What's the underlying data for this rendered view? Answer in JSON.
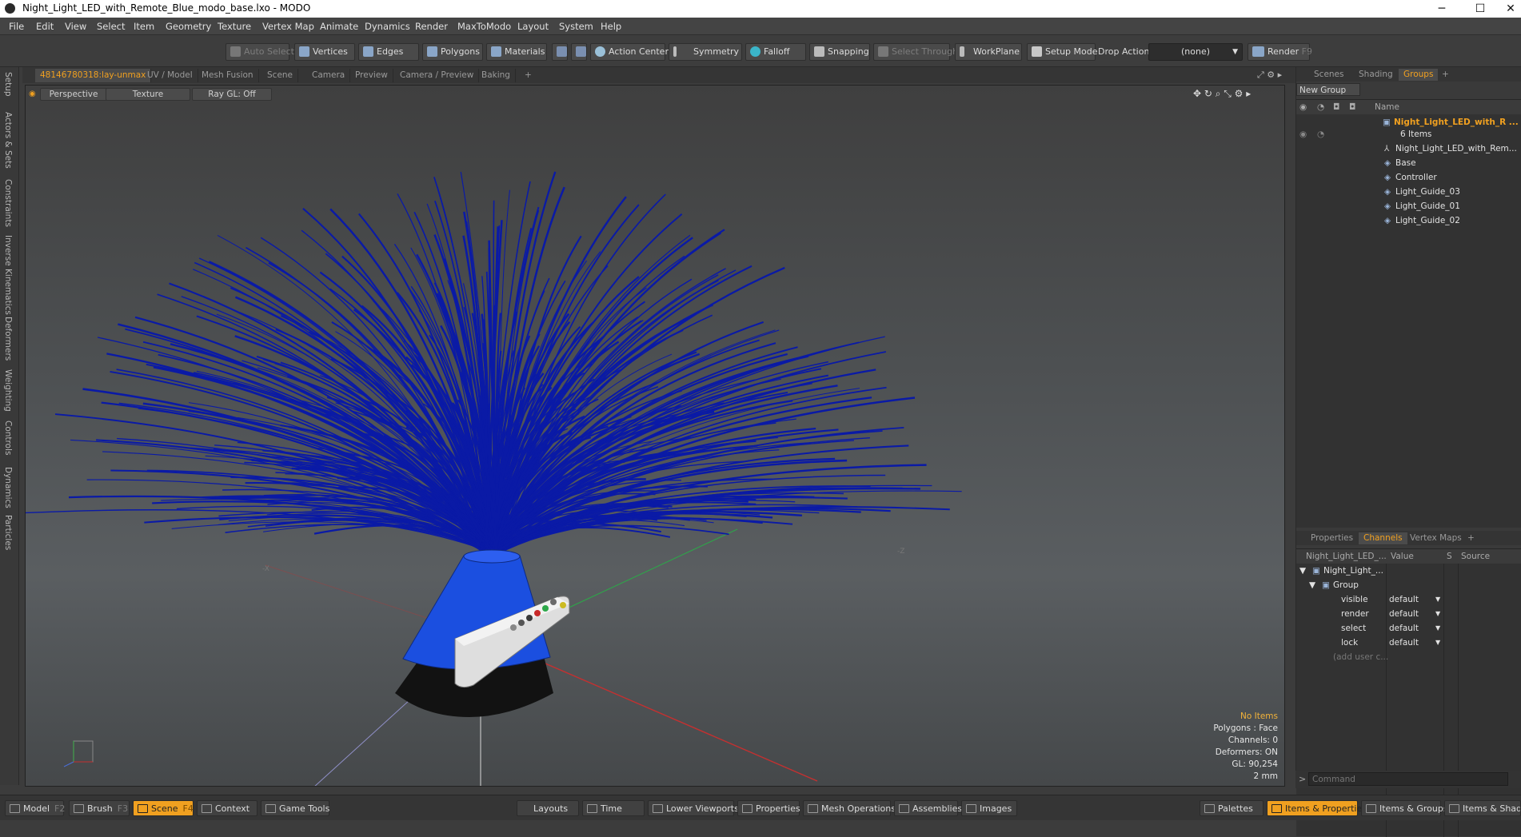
{
  "window": {
    "title": "Night_Light_LED_with_Remote_Blue_modo_base.lxo - MODO",
    "minimize": "─",
    "maximize": "☐",
    "close": "✕"
  },
  "menu": [
    "File",
    "Edit",
    "View",
    "Select",
    "Item",
    "Geometry",
    "Texture",
    "Vertex Map",
    "Animate",
    "Dynamics",
    "Render",
    "MaxToModo",
    "Layout",
    "System",
    "Help"
  ],
  "toolbar": {
    "auto_select": "Auto Select",
    "vertices": "Vertices",
    "edges": "Edges",
    "polygons": "Polygons",
    "materials": "Materials",
    "action_center": "Action Center",
    "symmetry": "Symmetry",
    "falloff": "Falloff",
    "snapping": "Snapping",
    "select_through": "Select Through",
    "workplane": "WorkPlane",
    "setup_mode": "Setup Mode",
    "drop_action": "Drop Action",
    "drop_value": "(none)",
    "render": "Render",
    "render_key": "F9"
  },
  "left_tabs": [
    "Setup",
    "Actors & Sets",
    "Constraints",
    "Inverse Kinematics",
    "Deformers",
    "Weighting",
    "Controls",
    "Dynamics",
    "Particles"
  ],
  "viewport_tabs": [
    "48146780318:lay-unmax",
    "UV / Model",
    "Mesh Fusion",
    "Scene",
    "Camera",
    "Preview",
    "Camera / Preview",
    "Baking",
    "+"
  ],
  "viewport": {
    "view": "Perspective",
    "shading": "Texture",
    "raygl": "Ray GL: Off",
    "axis_x": "-X",
    "axis_z": "-Z",
    "stats": {
      "items": "No Items",
      "polygons": "Polygons : Face",
      "channels": "Channels: 0",
      "deformers": "Deformers: ON",
      "gl": "GL: 90,254",
      "size": "2 mm"
    },
    "colors": {
      "fibers": "#0a1aa6",
      "base_top": "#1a4bd8",
      "base_bottom": "#121212"
    }
  },
  "scene_panel": {
    "tabs": [
      "Scenes",
      "Shading",
      "Groups",
      "+"
    ],
    "new_group": "New Group",
    "name_header": "Name",
    "group_name": "Night_Light_LED_with_R ...",
    "group_count": "6 Items",
    "items": [
      "Night_Light_LED_with_Rem...",
      "Base",
      "Controller",
      "Light_Guide_03",
      "Light_Guide_01",
      "Light_Guide_02"
    ]
  },
  "channels_panel": {
    "tabs": [
      "Properties",
      "Channels",
      "Vertex Maps",
      "+"
    ],
    "headers": {
      "name": "Night_Light_LED_...",
      "value": "Value",
      "s": "S",
      "source": "Source"
    },
    "root": "Night_Light_...",
    "group": "Group",
    "rows": [
      {
        "name": "visible",
        "value": "default"
      },
      {
        "name": "render",
        "value": "default"
      },
      {
        "name": "select",
        "value": "default"
      },
      {
        "name": "lock",
        "value": "default"
      }
    ],
    "add_user": "(add user c..."
  },
  "command": {
    "placeholder": "Command"
  },
  "bottom": [
    {
      "label": "Model",
      "key": "F2"
    },
    {
      "label": "Brush",
      "key": "F3"
    },
    {
      "label": "Scene",
      "key": "F4"
    },
    {
      "label": "Context",
      "key": ""
    },
    {
      "label": "Game Tools",
      "key": ""
    },
    {
      "label": "Layouts",
      "key": ""
    },
    {
      "label": "Time",
      "key": ""
    },
    {
      "label": "Lower Viewports",
      "key": ""
    },
    {
      "label": "Properties",
      "key": ""
    },
    {
      "label": "Mesh Operations",
      "key": ""
    },
    {
      "label": "Assemblies",
      "key": ""
    },
    {
      "label": "Images",
      "key": ""
    },
    {
      "label": "Palettes",
      "key": ""
    },
    {
      "label": "Items & Properties",
      "key": ""
    },
    {
      "label": "Items & Groups",
      "key": ""
    },
    {
      "label": "Items & Shading",
      "key": ""
    }
  ]
}
